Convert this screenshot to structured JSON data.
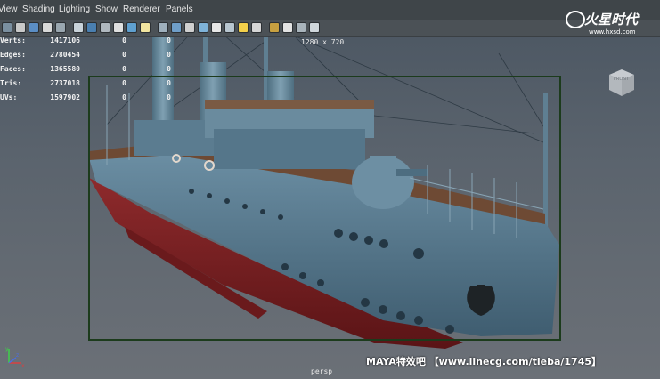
{
  "menus": [
    "View",
    "Shading",
    "Lighting",
    "Show",
    "Renderer",
    "Panels"
  ],
  "toolbar_icons": [
    "camera-icon",
    "camera-attributes-icon",
    "bookmark-icon",
    "image-plane-icon",
    "grid-toggle-icon",
    "wireframe-icon",
    "smooth-shade-icon",
    "shade-all-icon",
    "bounding-box-icon",
    "textured-icon",
    "use-lights-icon",
    "shadows-icon",
    "xray-icon",
    "backface-icon",
    "isolate-icon",
    "ambient-occlusion-icon",
    "anti-alias-icon",
    "default-light-icon",
    "sphere-light-icon",
    "select-camera-icon",
    "film-gate-icon",
    "resolution-gate-icon",
    "share-icon"
  ],
  "hud": {
    "rows": [
      {
        "label": "Verts:",
        "value": "1417106",
        "sel": "0",
        "sel2": "0"
      },
      {
        "label": "Edges:",
        "value": "2780454",
        "sel": "0",
        "sel2": "0"
      },
      {
        "label": "Faces:",
        "value": "1365580",
        "sel": "0",
        "sel2": "0"
      },
      {
        "label": "Tris:",
        "value": "2737018",
        "sel": "0",
        "sel2": "0"
      },
      {
        "label": "UVs:",
        "value": "1597902",
        "sel": "0",
        "sel2": "0"
      }
    ]
  },
  "viewport": {
    "resolution": "1280 x 720",
    "camera": "persp",
    "viewcube_face": "FRONT",
    "axis_labels": {
      "x": "x",
      "y": "y",
      "z": "z"
    }
  },
  "logo": {
    "cn": "火星时代",
    "url": "www.hxsd.com"
  },
  "watermark": "MAYA特效吧 【www.linecg.com/tieba/1745】",
  "colors": {
    "hull_blue": "#5a7d92",
    "hull_red": "#7a1f22",
    "deck_wood": "#6e4a34",
    "gate_green": "#1c3b1c",
    "menu_bg": "#3f4549"
  }
}
